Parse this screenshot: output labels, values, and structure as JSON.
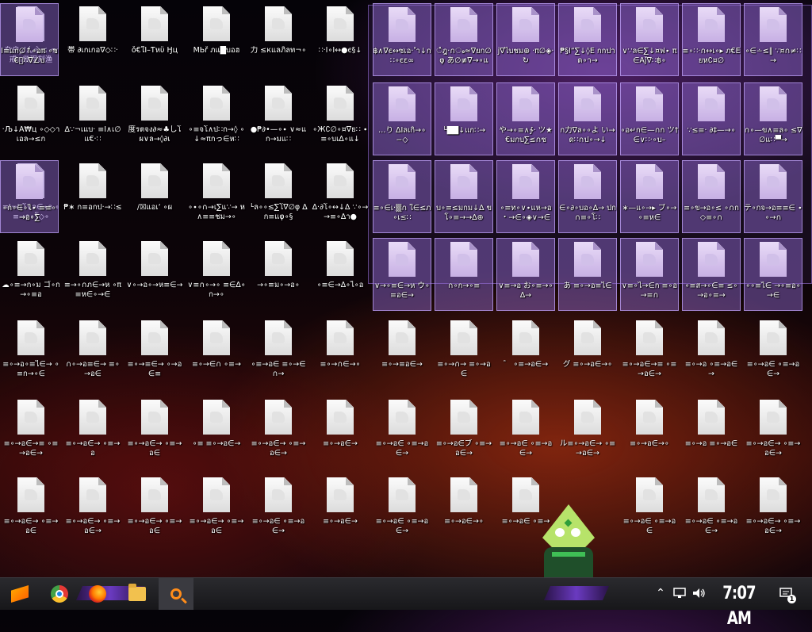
{
  "desktop": {
    "icon_labels": [
      [
        "㐇户لرん心≤ っ戒∩幾程刻渔",
        "帯 ∂เกเกอ∇◇∷·",
        "ǒ€ใİ–Ƭหϋ Ӈц",
        "ΜЬř ภแ█บอฮ",
        "力 ≤кแลภิลท¬∘",
        "∷·Ι∘Ι↔●є§↓",
        "฿∧∇є↔ซเ่อ· ำ↓ก∷∘єε∞",
        "ഀฎ·∩ം≈∇ยก∅φ あ∅≢∇→∘แ",
        "ј∇ไบชม⊕ ·π∅◈·↻",
        "₱§Ι“∑↓◊Ε กกปาด∘า→",
        "∨∵ล∈∑↓¤ฟ∙ π∈Αǰ∇∷฿∘",
        "≡∘∷·∩↔เ∘▸ ภ€Εยห∁¤∅",
        "∘∈∸≤∥ ∵¤∩≠∷→",
        "Ι≡แก∅↑∘อπ ∘ซ€ิ∴∇∠บ"
      ],
      [
        "·Љ↓Ã₩ц ∘◇◇าเอล→≤ก",
        "∆∵¬เแบ· ≡Ї∧เ∅แ€·∷",
        "度รตจง∂≈♣しโ ผ∨ล→◊∂เ",
        "∘≡จโ∧ป∷ก→◊ ∘↓≈πกっ∈ห∷",
        "●₱∂•—∘∙ ∨≈แก→มแ∷",
        "∘Ж∁∅∘¤∇ย∷ ∙≡∘บเ∆∘แ↓",
        "…り ΔΙลเกิ→∘−◇",
        "└██↓แก∷→",
        "や→∘≡∧∱· ツ★€มกบ∑≤∩ซ",
        "ก力∇ล∘∘よ い→ด∷∩ป∘→↓",
        "∘อ↵ก∈—∩ก ツ†∈∨∷·∘บ–",
        "∵≤≡· ∂‡—→∘",
        "∩∘—ข∧≡ล∘ ≤∇∅แ∷▀→"
      ],
      [
        "≡Ι¬Ʀโ∨ล∈∙ล ∘≡→ก∘โ◇∘",
        "₱∗ ก≡อกป·→∷≤",
        "∕☒แอเ‘ ∘ผ",
        "∘∙∘∩→เ∑แ∵→ ห∧≡≡ชม→∘",
        "└ล∘∘≤∑โ∇∅φ ∆ก≡แφ∘§",
        "∆·∂โ∘↔↓∆ ∵∘→→≡∘∆า●",
        "≡∘∈เ·▒∩ ใ∈≤ภ∘เ≤∷",
        "บ∘≡≤มกม↓∆ ขโ∘≡→→∆⊕",
        "∘≡ท∘∨∙แห→อ ・→∈∘◈∨→∈",
        "∈∘∂∘บอ∘∆→ ปก∩≡∘โ∷",
        "∗—แ∘→▸ ブ∘→∘≡ห∈",
        "≡∘ข→อ∘≤ ∘∩ก◇≡∘∩",
        "テ∘กจ→อ≡≡∈ ∙∘→∩",
        "∘ก∘∈∘ไ∙ ≡≡∘→อ∘∑"
      ],
      [
        "☁∘≡→ก∘ม ゴ∘ก→∘≡อ",
        "≡→∘∩ภ∈→ห ∘π≡ห∈∘→∈",
        "∨∘→อ∘→ห≡∈→",
        "∨≡∩∘→∘ ≡∈∆∘ก→∘",
        "→∘≡ม∘→อ∘",
        "∘≡∈→∆∘ไ∘อ",
        "∨→∘≡∈→ห ウ∘≡อ∈→",
        "∩∘ก→∘≡",
        "∨≡→อ お∘≡→∘∆→",
        "あ ≡∘→อ≡ไ∈",
        "∨≡∘ไ→∈ก ≡∘อ→≡∩",
        "∘≡ส→∘∈≡ ≤∘→อ∘≡→",
        "∘∘≡ไ∈ →∘≡อ∘→∈"
      ],
      [
        "≡∘→อ∘≡ไ∈→ ∘≡ก→∘∈",
        "∩∘→อ≡∈→ ≡∘→อ∈",
        "≡∘→≡∈→ ∘→อ∈≡",
        "≡∘→∈∩ ∘≡→",
        "∘≡→อ∈ ≡∘→∈∩→",
        "≡∘→∩∈→∘",
        "≡∘→≡อ∈→",
        "≡∘→∩→ ≡∘→อ∈",
        "゛ ∘≡→อ∈→",
        "グ ≡∘→อ∈→∘",
        "≡∘→อ∈→≡ ∘≡→อ∈→",
        "≡∘→อ ∘≡→อ∈→",
        "≡∘→อ∈ ∘≡→อ∈→"
      ],
      [
        "≡∘→อ∈→≡ ∘≡→อ∈→",
        "≡∘→อ∈→ ∘≡→อ",
        "≡∘→อ∈→ ∘≡→อ∈",
        "∘≡ ≡∘→อ∈→",
        "≡∘→อ∈→ ∘≡→อ∈→",
        "≡∘→อ∈→",
        "≡∘→อ∈ ∘≡→อ∈→",
        "≡∘→อ∈ブ ∘≡→อ∈→",
        "≡∘→อ∈ ∘≡→อ∈→",
        "ル≡∘→อ∈→ ∘≡→อ∈→",
        "≡∘→อ∈→∘",
        "≡∘→อ ≡∘→อ∈",
        "≡∘→อ∈→ ∘≡→อ∈→"
      ],
      [
        "≡∘→อ∈→ ∘≡→อ∈",
        "≡∘→อ∈→ ∘≡→อ∈→",
        "≡∘→อ∈→ ∘≡→อ∈",
        "≡∘→อ∈→ ∘≡→อ∈",
        "≡∘→อ∈ ∘≡→อ∈→",
        "≡∘→อ∈→",
        "≡∘→อ∈ ∘≡→อ∈→",
        "≡∘→อ∈→∘",
        "≡∘→อ∈ ∘≡→",
        "",
        "≡∘→อ∈ ∘≡→อ∈",
        "≡∘→อ∈ ∘≡→อ∈→",
        "≡∘→อ∈→ ∘≡→อ∈→"
      ]
    ],
    "selected_columns_start": 6,
    "selected_rows": 4
  },
  "taskbar": {
    "pinned": [
      "start-logo",
      "chrome-icon",
      "firefox-icon",
      "file-explorer-icon",
      "search-icon"
    ],
    "tray_icons": [
      "chevron-up-icon",
      "network-icon",
      "volume-icon"
    ],
    "clock": "7:07 AM",
    "notification_count": "1"
  },
  "colors": {
    "selection": "#9a6ee0",
    "taskbar": "#1f1f23",
    "accent_bar": "#6a3ac0",
    "search_accent": "#ff8c1a"
  }
}
